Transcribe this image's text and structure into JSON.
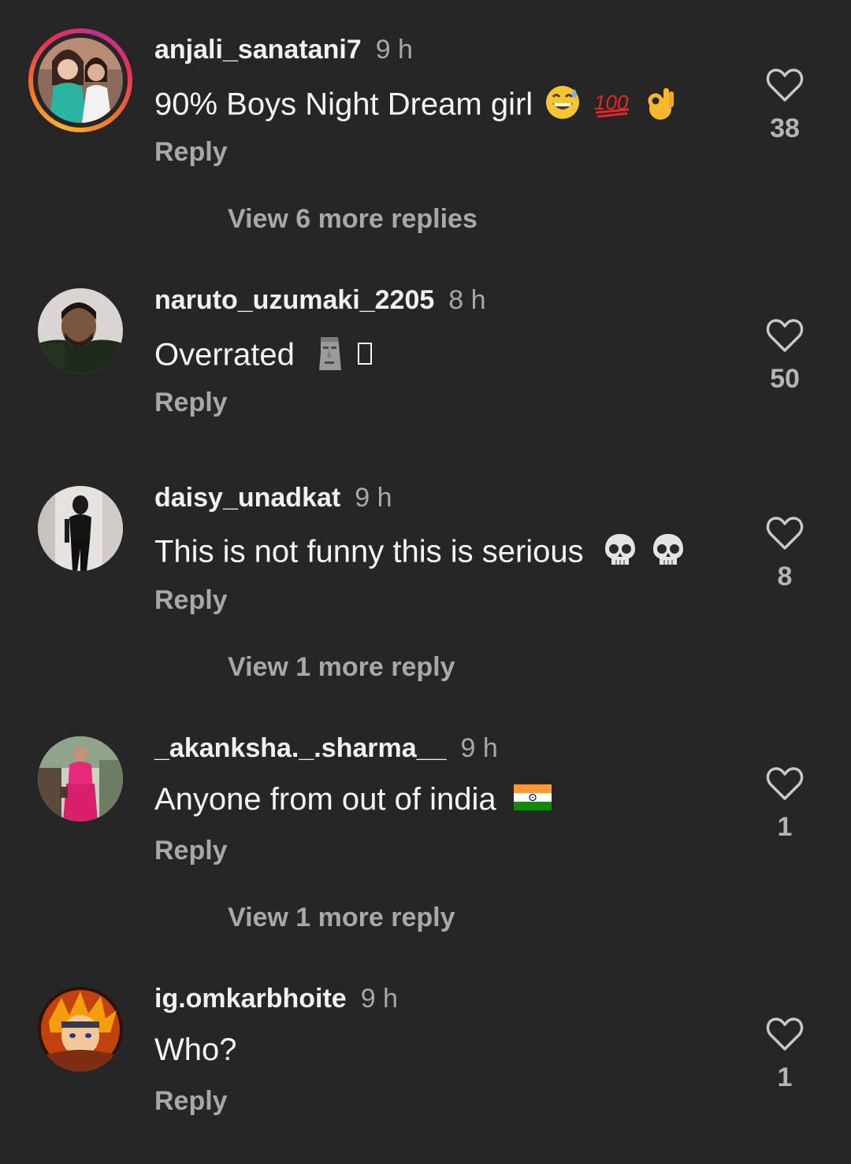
{
  "comments": [
    {
      "username": "anjali_sanatani7",
      "time": "9 h",
      "text": "90% Boys Night Dream girl",
      "emojis": [
        "grinning-sweat-emoji",
        "hundred-points-emoji",
        "ok-hand-emoji"
      ],
      "reply_label": "Reply",
      "likes": "38",
      "view_more": "View 6 more replies",
      "has_story_ring": true
    },
    {
      "username": "naruto_uzumaki_2205",
      "time": "8 h",
      "text": "Overrated",
      "emojis": [
        "moai-emoji",
        "missing-glyph"
      ],
      "reply_label": "Reply",
      "likes": "50"
    },
    {
      "username": "daisy_unadkat",
      "time": "9 h",
      "text": "This is not funny this is serious",
      "emojis": [
        "skull-emoji",
        "skull-emoji"
      ],
      "reply_label": "Reply",
      "likes": "8",
      "view_more": "View 1 more reply"
    },
    {
      "username": "_akanksha._.sharma__",
      "time": "9 h",
      "text": "Anyone from out of india",
      "emojis": [
        "india-flag-emoji"
      ],
      "reply_label": "Reply",
      "likes": "1",
      "view_more": "View 1 more reply"
    },
    {
      "username": "ig.omkarbhoite",
      "time": "9 h",
      "text": "Who?",
      "emojis": [],
      "reply_label": "Reply",
      "likes": "1"
    }
  ],
  "colors": {
    "background": "#262626",
    "primary_text": "#f5f5f5",
    "secondary_text": "#a8a8a8"
  }
}
